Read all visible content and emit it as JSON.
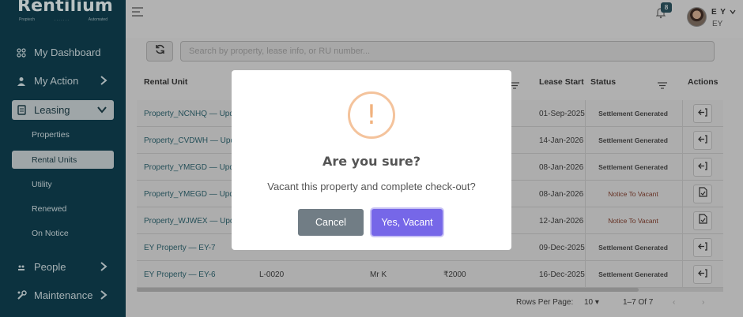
{
  "brand": {
    "name": "Rentilium",
    "tagline_left": "Proptech",
    "tagline_dots": ". . . . . . .",
    "tagline_right": "Automated"
  },
  "sidebar": {
    "items": [
      {
        "label": "My Dashboard",
        "icon": "dashboard-icon"
      },
      {
        "label": "My Action",
        "icon": "user-icon"
      },
      {
        "label": "Leasing",
        "icon": "document-icon"
      },
      {
        "label": "People",
        "icon": "people-icon"
      },
      {
        "label": "Maintenance",
        "icon": "wrench-icon"
      }
    ],
    "leasing_sub": [
      "Properties",
      "Rental Units",
      "Utility",
      "Renewed",
      "On Notice"
    ],
    "active_sub": "Rental Units"
  },
  "topbar": {
    "notification_count": "8",
    "user_initials": "E Y",
    "user_sub": "EY"
  },
  "search": {
    "placeholder": "Search by property, lease info, or RU number..."
  },
  "table": {
    "headers": {
      "unit": "Rental Unit",
      "lease_start": "Lease Start",
      "status": "Status",
      "actions": "Actions"
    },
    "rows": [
      {
        "unit": "Property_NCNHQ — Upda",
        "lease": "",
        "tenant": "",
        "rent": "",
        "start": "01-Sep-2025",
        "status": "Settlement Generated",
        "status_type": "settled",
        "action": "checkout"
      },
      {
        "unit": "Property_CVDWH — Upda",
        "lease": "",
        "tenant": "",
        "rent": "",
        "start": "14-Jan-2026",
        "status": "Settlement Generated",
        "status_type": "settled",
        "action": "checkout"
      },
      {
        "unit": "Property_YMEGD — Upda",
        "lease": "",
        "tenant": "",
        "rent": "",
        "start": "08-Jan-2026",
        "status": "Settlement Generated",
        "status_type": "settled",
        "action": "checkout"
      },
      {
        "unit": "Property_YMEGD — Upda",
        "lease": "",
        "tenant": "",
        "rent": "",
        "start": "08-Jan-2026",
        "status": "Notice To Vacant",
        "status_type": "notice",
        "action": "document"
      },
      {
        "unit": "Property_WJWEX — Upda",
        "lease": "",
        "tenant": "",
        "rent": "",
        "start": "12-Jan-2026",
        "status": "Notice To Vacant",
        "status_type": "notice",
        "action": "document"
      },
      {
        "unit": "EY Property — EY-7",
        "lease": "",
        "tenant": "",
        "rent": "",
        "start": "09-Dec-2025",
        "status": "Settlement Generated",
        "status_type": "settled",
        "action": "checkout"
      },
      {
        "unit": "EY Property — EY-6",
        "lease": "L-0020",
        "tenant": "Mr K",
        "rent": "₹2000",
        "start": "16-Dec-2025",
        "status": "Settlement Generated",
        "status_type": "settled",
        "action": "checkout"
      }
    ]
  },
  "pagination": {
    "rows_per_page_label": "Rows Per Page:",
    "rows_per_page": "10",
    "range": "1–7 Of 7"
  },
  "modal": {
    "icon_glyph": "!",
    "title": "Are you sure?",
    "text": "Vacant this property and complete check-out?",
    "cancel_label": "Cancel",
    "confirm_label": "Yes, Vacant",
    "accent": "#7667e8",
    "warn_color": "#f4c39c"
  }
}
